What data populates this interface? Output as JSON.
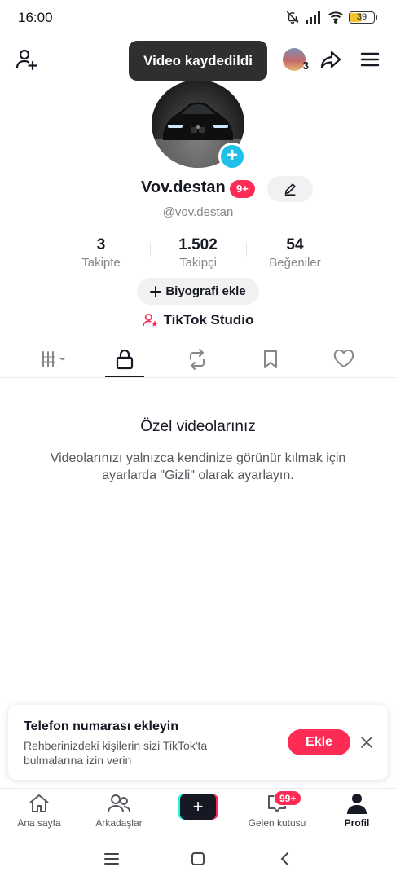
{
  "status_bar": {
    "time": "16:00",
    "battery": "39",
    "icons": [
      "bell-off-icon",
      "signal-icon",
      "wifi-icon",
      "battery-icon"
    ]
  },
  "top_bar": {
    "toast": "Video kaydedildi",
    "story_count": "3",
    "icons": [
      "add-friend-icon",
      "share-icon",
      "menu-icon"
    ]
  },
  "profile": {
    "display_name": "Vov.destan",
    "badge": "9+",
    "handle": "@vov.destan",
    "stats": [
      {
        "value": "3",
        "label": "Takipte"
      },
      {
        "value": "1.502",
        "label": "Takipçi"
      },
      {
        "value": "54",
        "label": "Beğeniler"
      }
    ],
    "bio_button": "Biyografi ekle",
    "studio_label": "TikTok Studio"
  },
  "tabs": [
    {
      "icon": "grid-filter-icon",
      "active": false
    },
    {
      "icon": "lock-icon",
      "active": true
    },
    {
      "icon": "repost-icon",
      "active": false
    },
    {
      "icon": "bookmark-icon",
      "active": false
    },
    {
      "icon": "heart-icon",
      "active": false
    }
  ],
  "empty_state": {
    "title": "Özel videolarınız",
    "description": "Videolarınızı yalnızca kendinize görünür kılmak için ayarlarda \"Gizli\" olarak ayarlayın."
  },
  "phone_card": {
    "title": "Telefon numarası ekleyin",
    "description": "Rehberinizdeki kişilerin sizi TikTok'ta bulmalarına izin verin",
    "button": "Ekle"
  },
  "bottom_nav": {
    "items": [
      {
        "label": "Ana sayfa",
        "icon": "home-icon"
      },
      {
        "label": "Arkadaşlar",
        "icon": "friends-icon"
      },
      {
        "label": "",
        "icon": "create-icon"
      },
      {
        "label": "Gelen kutusu",
        "icon": "inbox-icon"
      },
      {
        "label": "Profil",
        "icon": "profile-icon"
      }
    ],
    "inbox_badge": "99+"
  },
  "colors": {
    "accent": "#fe2c55",
    "cyan": "#20c1e8",
    "text": "#161823",
    "muted": "#86878b"
  }
}
